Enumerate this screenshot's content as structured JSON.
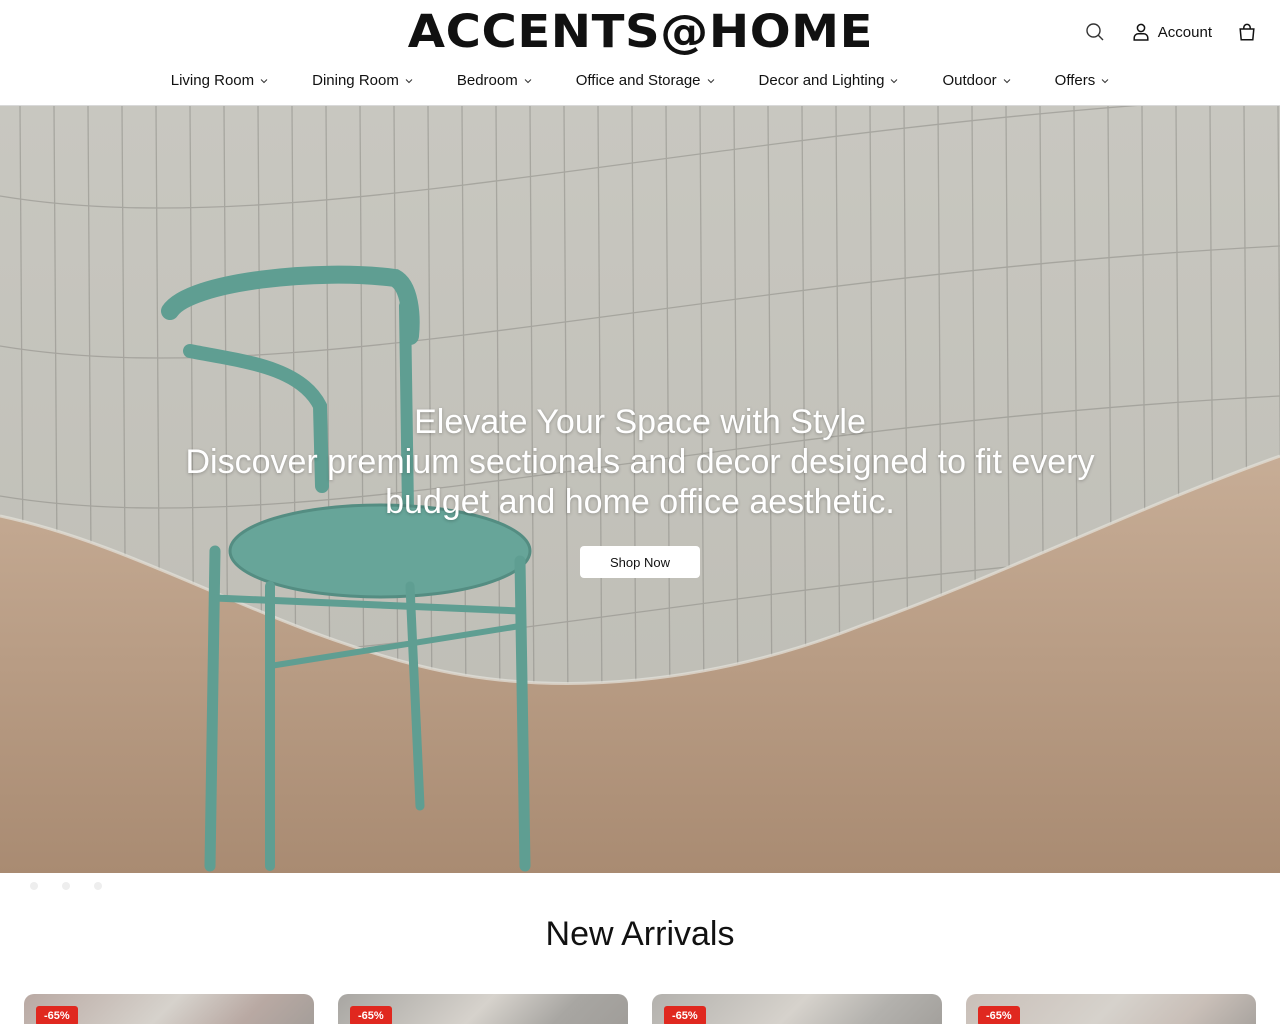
{
  "brand": {
    "logo_text": "ACCENTS@HOME"
  },
  "header": {
    "search_icon": "search-icon",
    "account_label": "Account",
    "account_icon": "user-icon",
    "cart_icon": "shopping-bag-icon"
  },
  "nav": {
    "items": [
      {
        "label": "Living Room"
      },
      {
        "label": "Dining Room"
      },
      {
        "label": "Bedroom"
      },
      {
        "label": "Office and Storage"
      },
      {
        "label": "Decor and Lighting"
      },
      {
        "label": "Outdoor"
      },
      {
        "label": "Offers"
      }
    ]
  },
  "hero": {
    "title": "Elevate Your Space with Style",
    "subtitle": "Discover premium sectionals and decor designed to fit every budget and home office aesthetic.",
    "cta_label": "Shop Now",
    "slide_count": 3
  },
  "new_arrivals": {
    "heading": "New Arrivals",
    "products": [
      {
        "badge": "-65%",
        "swatch": "#b9a9a3"
      },
      {
        "badge": "-65%",
        "swatch": "#a8a6a2"
      },
      {
        "badge": "-65%",
        "swatch": "#b3b1ad"
      },
      {
        "badge": "-65%",
        "swatch": "#c9bfb8"
      }
    ]
  },
  "colors": {
    "sale_badge": "#e0281f",
    "chair": "#5f9e92",
    "wall": "#c6c5be",
    "floor": "#b8967a"
  }
}
